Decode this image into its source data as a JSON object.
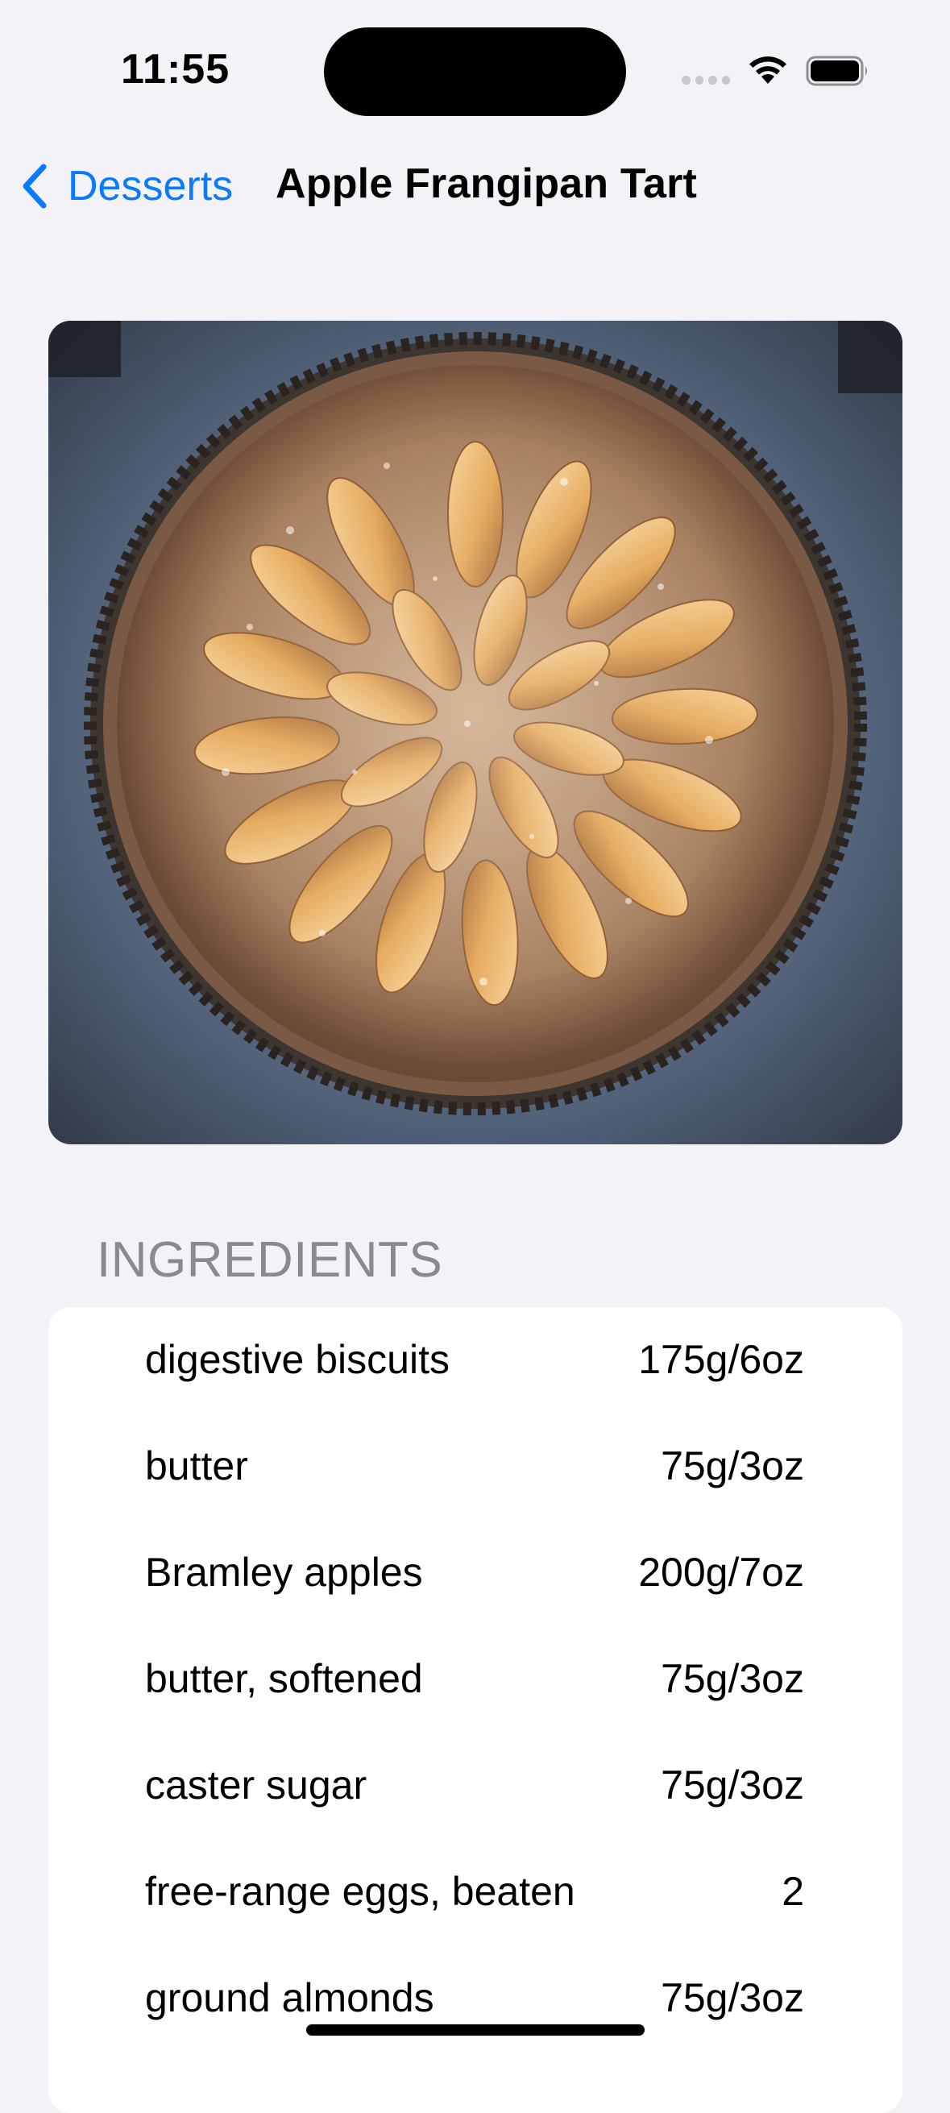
{
  "status_bar": {
    "time": "11:55"
  },
  "nav": {
    "back_label": "Desserts",
    "title": "Apple Frangipan Tart"
  },
  "hero_image": {
    "icon": "tart-photo"
  },
  "ingredients": {
    "header": "INGREDIENTS",
    "items": [
      {
        "name": "digestive biscuits",
        "qty": "175g/6oz"
      },
      {
        "name": "butter",
        "qty": "75g/3oz"
      },
      {
        "name": "Bramley apples",
        "qty": "200g/7oz"
      },
      {
        "name": "butter, softened",
        "qty": "75g/3oz"
      },
      {
        "name": "caster sugar",
        "qty": "75g/3oz"
      },
      {
        "name": "free-range eggs, beaten",
        "qty": "2"
      },
      {
        "name": "ground almonds",
        "qty": "75g/3oz"
      }
    ]
  },
  "colors": {
    "background": "#F2F2F7",
    "accent": "#0A7AFF",
    "secondary_text": "#8A8A8E"
  }
}
